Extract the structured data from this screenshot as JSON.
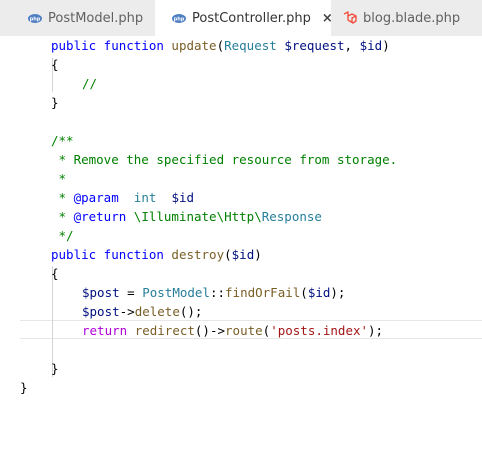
{
  "tabs": [
    {
      "label": "PostModel.php",
      "icon": "php-icon",
      "active": false
    },
    {
      "label": "PostController.php",
      "icon": "php-icon",
      "active": true,
      "close": "×"
    },
    {
      "label": "blog.blade.php",
      "icon": "laravel-icon",
      "active": false
    }
  ],
  "icons": {
    "php": "php",
    "php_color": "#4f7ec2",
    "laravel_color": "#f0513f"
  },
  "code": {
    "l1": {
      "kw": "public function ",
      "fn": "update",
      "p1": "(",
      "ty": "Request",
      "sp": " ",
      "v1": "$request",
      "comma": ", ",
      "v2": "$id",
      "p2": ")"
    },
    "l2": "{",
    "l3": "//",
    "l4": "}",
    "l5": "/**",
    "l6": " * Remove the specified resource from storage.",
    "l7": " *",
    "l8": {
      "pre": " * ",
      "tag": "@param",
      "mid": "  ",
      "type": "int",
      "gap": "  ",
      "var": "$id"
    },
    "l9": {
      "pre": " * ",
      "tag": "@return",
      "sp": " ",
      "ns1": "\\Illuminate\\Http\\",
      "cls": "Response"
    },
    "l10": " */",
    "l11": {
      "kw": "public function ",
      "fn": "destroy",
      "p1": "(",
      "v1": "$id",
      "p2": ")"
    },
    "l12": "{",
    "l13": {
      "v1": "$post",
      "eq": " = ",
      "cls": "PostModel",
      "op": "::",
      "fn": "findOrFail",
      "p1": "(",
      "v2": "$id",
      "p2": ");"
    },
    "l14": {
      "v1": "$post",
      "op": "->",
      "fn": "delete",
      "p": "();"
    },
    "l15": {
      "kw": "return",
      "sp": " ",
      "fn1": "redirect",
      "p1": "()->",
      "fn2": "route",
      "p2": "(",
      "str": "'posts.index'",
      "p3": ");"
    },
    "l16": "}",
    "l17": "}"
  }
}
